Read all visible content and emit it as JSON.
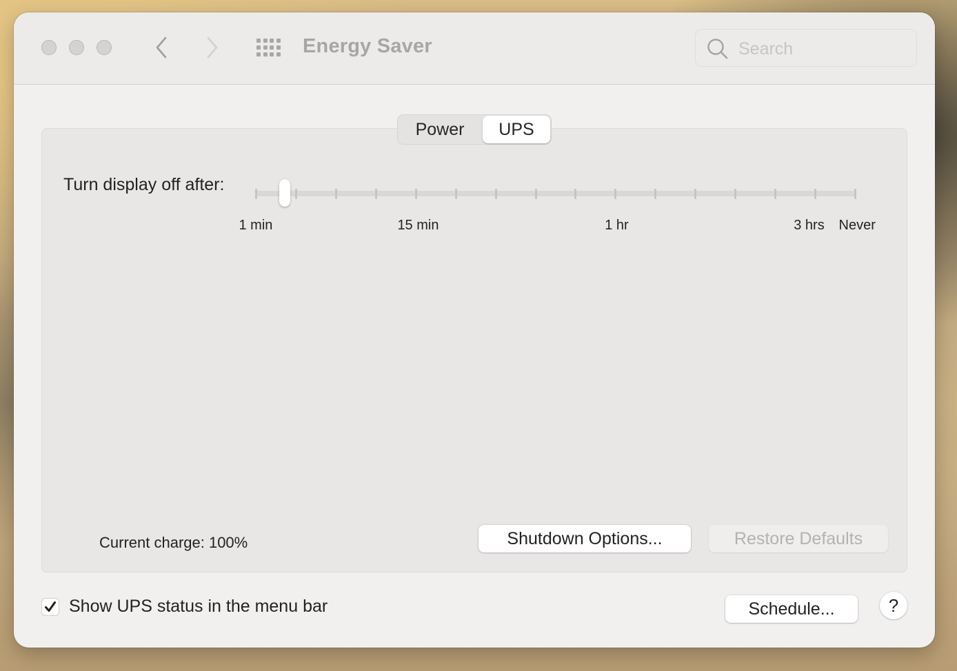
{
  "window": {
    "title": "Energy Saver",
    "traffic_lights": [
      "close",
      "minimize",
      "zoom"
    ],
    "nav": {
      "back_icon": "chevron-left-icon",
      "forward_icon": "chevron-right-icon",
      "grid_icon": "show-all-grid-icon"
    },
    "search": {
      "placeholder": "Search",
      "value": ""
    }
  },
  "tabs": [
    {
      "label": "Power",
      "selected": false
    },
    {
      "label": "UPS",
      "selected": true
    }
  ],
  "display_off": {
    "label": "Turn display off after:",
    "tick_count": 16,
    "selected_value": "2 min",
    "selected_position": 0.04,
    "scale_labels": [
      {
        "text": "1 min",
        "at": 0.0
      },
      {
        "text": "15 min",
        "at": 0.27
      },
      {
        "text": "1 hr",
        "at": 0.6
      },
      {
        "text": "3 hrs",
        "at": 0.92
      },
      {
        "text": "Never",
        "at": 1.0
      }
    ]
  },
  "status": {
    "current_charge": "Current charge: 100%"
  },
  "buttons": {
    "shutdown_options": "Shutdown Options...",
    "restore_defaults": "Restore Defaults",
    "schedule": "Schedule...",
    "help": "?"
  },
  "checkbox": {
    "label": "Show UPS status in the menu bar",
    "checked": true
  },
  "colors": {
    "window_bg": "#f1f0ef",
    "toolbar_bg": "#ecebea",
    "panel_bg": "#e8e7e6",
    "disabled_text": "#b3b2b1",
    "text": "#222222"
  }
}
